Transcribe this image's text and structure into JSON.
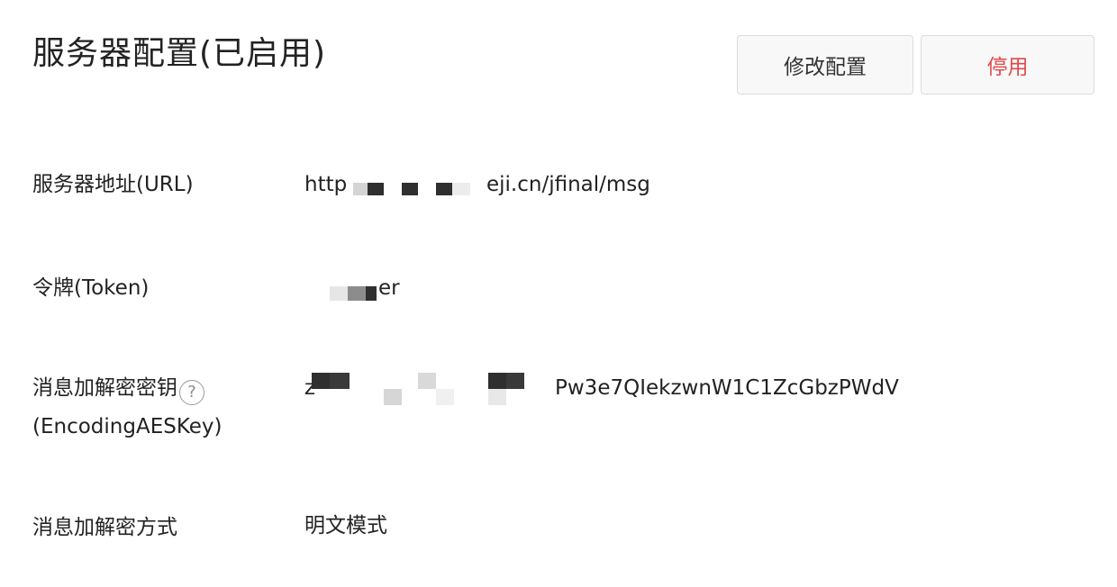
{
  "header": {
    "title": "服务器配置(已启用)",
    "edit_button": "修改配置",
    "disable_button": "停用"
  },
  "colors": {
    "danger": "#e0494a",
    "text": "#222222",
    "button_bg": "#f8f8f8",
    "button_border": "#dcdcdc"
  },
  "config": {
    "url": {
      "label": "服务器地址(URL)",
      "value_start": "http",
      "value_end": "eji.cn/jfinal/msg"
    },
    "token": {
      "label": "令牌(Token)",
      "value_end": "er"
    },
    "aes_key": {
      "label_line1": "消息加解密密钥",
      "label_line2": "(EncodingAESKey)",
      "help_icon": "?",
      "value_start": "z",
      "value_end": "Pw3e7QIekzwnW1C1ZcGbzPWdV"
    },
    "mode": {
      "label": "消息加解密方式",
      "value": "明文模式"
    }
  }
}
